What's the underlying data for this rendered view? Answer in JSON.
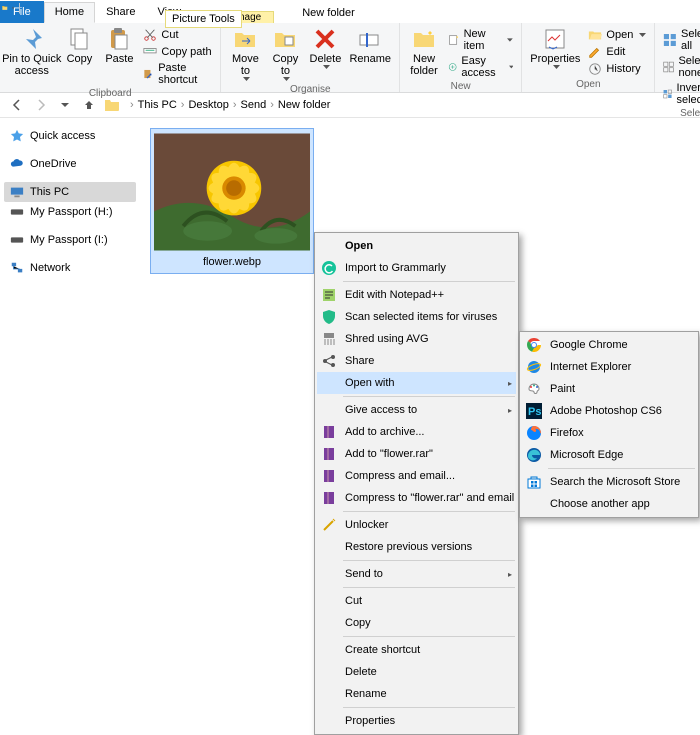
{
  "window": {
    "title": "New folder"
  },
  "tabs": {
    "file": "File",
    "home": "Home",
    "share": "Share",
    "view": "View",
    "context_group": "Manage",
    "context_tab": "Picture Tools"
  },
  "ribbon": {
    "clipboard": {
      "label": "Clipboard",
      "pin": "Pin to Quick\naccess",
      "copy": "Copy",
      "paste": "Paste",
      "cut": "Cut",
      "copy_path": "Copy path",
      "paste_shortcut": "Paste shortcut"
    },
    "organise": {
      "label": "Organise",
      "move_to": "Move\nto",
      "copy_to": "Copy\nto",
      "delete": "Delete",
      "rename": "Rename"
    },
    "new": {
      "label": "New",
      "new_folder": "New\nfolder",
      "new_item": "New item",
      "easy_access": "Easy access"
    },
    "open": {
      "label": "Open",
      "properties": "Properties",
      "open": "Open",
      "edit": "Edit",
      "history": "History"
    },
    "select": {
      "label": "Select",
      "select_all": "Select all",
      "select_none": "Select none",
      "invert": "Invert selection"
    }
  },
  "breadcrumb": {
    "segments": [
      "This PC",
      "Desktop",
      "Send",
      "New folder"
    ]
  },
  "nav": {
    "quick_access": "Quick access",
    "onedrive": "OneDrive",
    "this_pc": "This PC",
    "passport_h": "My Passport (H:)",
    "passport_i": "My Passport (I:)",
    "network": "Network"
  },
  "file_item": {
    "name": "flower.webp"
  },
  "ctx": {
    "open": "Open",
    "grammarly": "Import to Grammarly",
    "notepadpp": "Edit with Notepad++",
    "scan": "Scan selected items for viruses",
    "shred": "Shred using AVG",
    "share": "Share",
    "open_with": "Open with",
    "give_access": "Give access to",
    "add_archive": "Add to archive...",
    "add_flower": "Add to \"flower.rar\"",
    "compress_email": "Compress and email...",
    "compress_flower_email": "Compress to \"flower.rar\" and email",
    "unlocker": "Unlocker",
    "restore": "Restore previous versions",
    "send_to": "Send to",
    "cut": "Cut",
    "copy": "Copy",
    "create_shortcut": "Create shortcut",
    "delete": "Delete",
    "rename": "Rename",
    "properties": "Properties"
  },
  "submenu": {
    "chrome": "Google Chrome",
    "ie": "Internet Explorer",
    "paint": "Paint",
    "photoshop": "Adobe Photoshop CS6",
    "firefox": "Firefox",
    "edge": "Microsoft Edge",
    "store": "Search the Microsoft Store",
    "choose": "Choose another app"
  },
  "colors": {
    "blue": "#1979ca",
    "yellow": "#fff1a8",
    "select_bg": "#cee5ff"
  }
}
